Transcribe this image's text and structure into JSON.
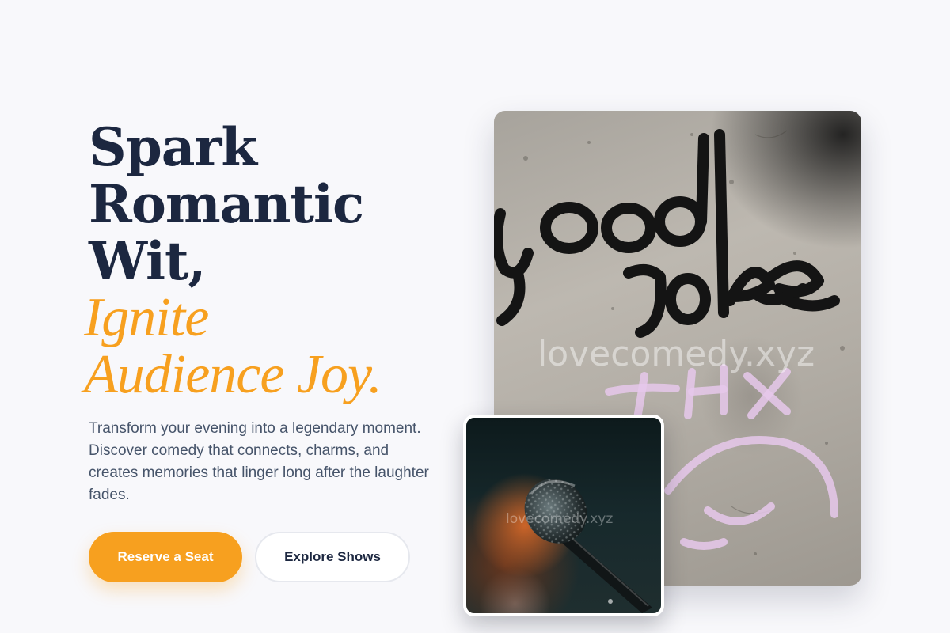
{
  "hero": {
    "headline_line1": "Spark",
    "headline_line2": "Romantic",
    "headline_line3": "Wit,",
    "headline_accent1": "Ignite",
    "headline_accent2": "Audience Joy.",
    "description": "Transform your evening into a legendary moment. Discover comedy that connects, charms, and creates memories that linger long after the laughter fades."
  },
  "buttons": {
    "primary_label": "Reserve a Seat",
    "secondary_label": "Explore Shows"
  },
  "images": {
    "main_graffiti_words": [
      "good",
      "joke",
      "THX"
    ],
    "main_watermark": "lovecomedy.xyz",
    "inset_watermark": "lovecomedy.xyz"
  },
  "colors": {
    "accent": "#f7a01f",
    "heading": "#1c2740",
    "body_text": "#46546a",
    "background": "#f8f8fb"
  }
}
